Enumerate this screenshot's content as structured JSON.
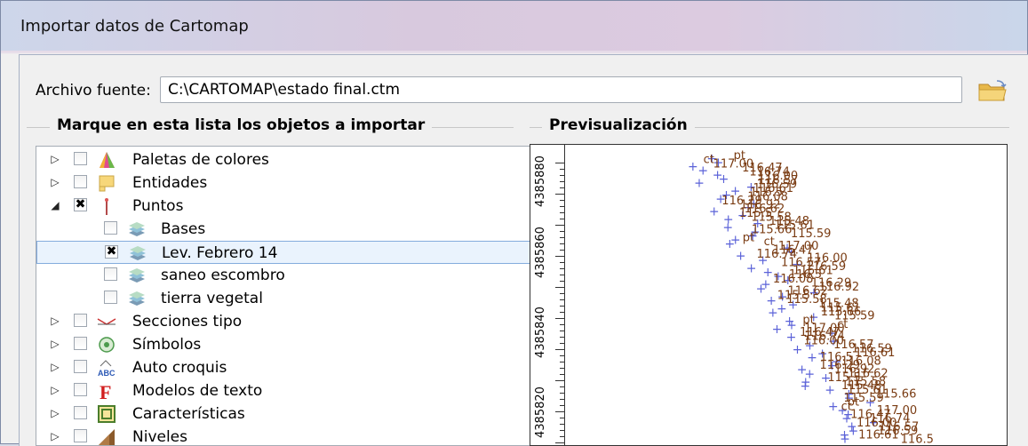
{
  "window": {
    "title": "Importar datos de Cartomap"
  },
  "source": {
    "label": "Archivo fuente:",
    "value": "C:\\CARTOMAP\\estado final.ctm"
  },
  "list_group": {
    "title": "Marque en esta lista los objetos a importar"
  },
  "preview_group": {
    "title": "Previsualización"
  },
  "tree": [
    {
      "label": "Paletas de colores",
      "level": 0,
      "expander": "▷",
      "checked": false,
      "icon": "palette-icon"
    },
    {
      "label": "Entidades",
      "level": 0,
      "expander": "▷",
      "checked": false,
      "icon": "entities-icon"
    },
    {
      "label": "Puntos",
      "level": 0,
      "expander": "◢",
      "checked": true,
      "icon": "point-icon"
    },
    {
      "label": "Bases",
      "level": 1,
      "expander": "",
      "checked": false,
      "icon": "layer-icon"
    },
    {
      "label": "Lev. Febrero 14",
      "level": 1,
      "expander": "",
      "checked": true,
      "icon": "layer-icon",
      "selected": true
    },
    {
      "label": "saneo escombro",
      "level": 1,
      "expander": "",
      "checked": false,
      "icon": "layer-icon"
    },
    {
      "label": "tierra vegetal",
      "level": 1,
      "expander": "",
      "checked": false,
      "icon": "layer-icon"
    },
    {
      "label": "Secciones tipo",
      "level": 0,
      "expander": "▷",
      "checked": false,
      "icon": "section-icon"
    },
    {
      "label": "Símbolos",
      "level": 0,
      "expander": "▷",
      "checked": false,
      "icon": "symbol-icon"
    },
    {
      "label": "Auto croquis",
      "level": 0,
      "expander": "▷",
      "checked": false,
      "icon": "abc-icon"
    },
    {
      "label": "Modelos de texto",
      "level": 0,
      "expander": "▷",
      "checked": false,
      "icon": "text-model-icon"
    },
    {
      "label": "Características",
      "level": 0,
      "expander": "▷",
      "checked": false,
      "icon": "features-icon"
    },
    {
      "label": "Niveles",
      "level": 0,
      "expander": "▷",
      "checked": false,
      "icon": "levels-icon"
    }
  ],
  "preview_axis": {
    "labels": [
      "4385880",
      "4385860",
      "4385840",
      "4385820"
    ]
  },
  "preview_points": {
    "labels": [
      "pt",
      "ct",
      "117.00",
      "116.47",
      "116.74",
      "116.00",
      "116.57",
      "116.59",
      "116.61",
      "116.5",
      "116.08",
      "116.29",
      "116.92",
      "116.62",
      "115.5",
      "115.58",
      "115.48",
      "115.61",
      "115.66",
      "115.59"
    ]
  },
  "colors": {
    "accent_select": "#84acdd",
    "marker": "#5b62d8",
    "label": "#7a3c13"
  }
}
